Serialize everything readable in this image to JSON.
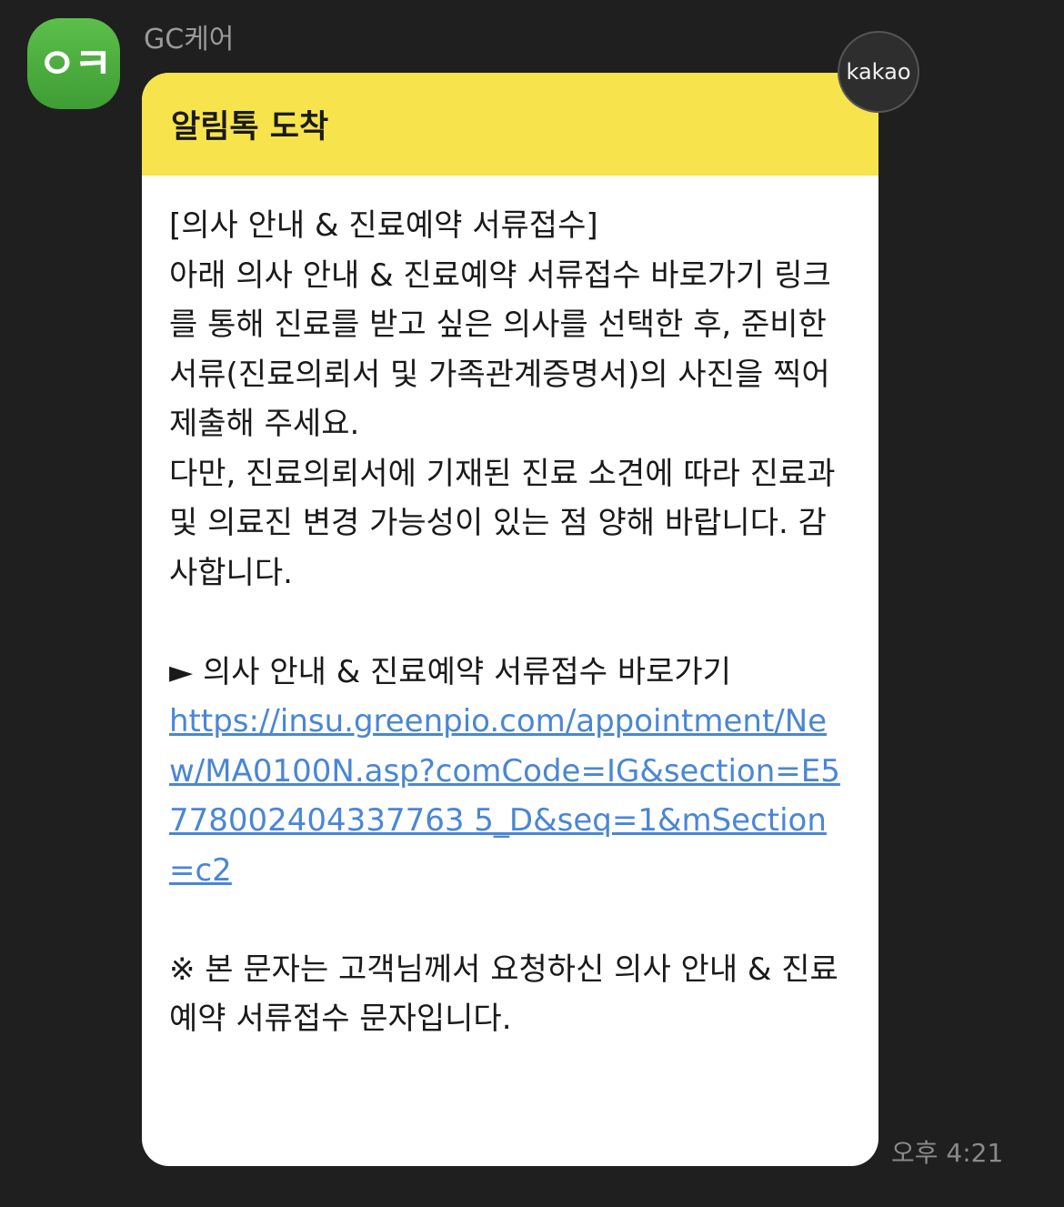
{
  "sender": {
    "name": "GC케어",
    "avatar_text": "ㅇㅋ",
    "avatar_color": "#4cae3c"
  },
  "badge": {
    "label": "kakao"
  },
  "message": {
    "header_title": "알림톡 도착",
    "header_color": "#f7e34c",
    "paragraphs": {
      "title_line": "[의사 안내 & 진료예약 서류접수]",
      "intro": "아래 의사 안내 & 진료예약 서류접수 바로가기 링크를 통해 진료를 받고 싶은 의사를 선택한 후, 준비한 서류(진료의뢰서 및 가족관계증명서)의 사진을 찍어 제출해 주세요.",
      "notice": "다만, 진료의뢰서에 기재된 진료 소견에 따라 진료과 및 의료진 변경 가능성이 있는 점 양해 바랍니다. 감사합니다.",
      "shortcut_label": "► 의사 안내 & 진료예약 서류접수 바로가기",
      "link_url": "https://insu.greenpio.com/appointment/New/MA0100N.asp?comCode=IG&section=E5778002404337763 5_D&seq=1&mSection=c2",
      "footer": "※ 본 문자는 고객님께서 요청하신 의사 안내 & 진료예약 서류접수 문자입니다."
    }
  },
  "timestamp": "오후 4:21"
}
